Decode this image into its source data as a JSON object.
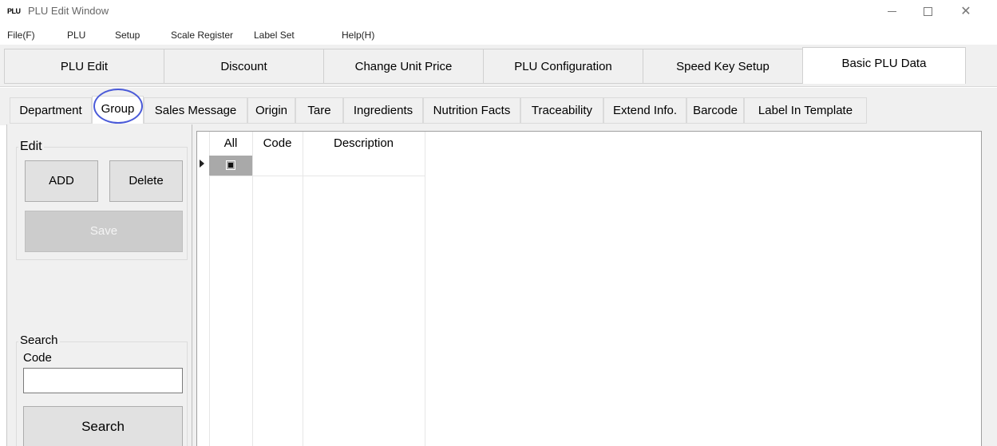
{
  "window": {
    "logo_text": "PLU",
    "title": "PLU Edit Window",
    "minimize_label": "—",
    "maximize_label": "☐",
    "close_label": "✕"
  },
  "menu": [
    "File(F)",
    "PLU",
    "Setup",
    "Scale Register",
    "Label Set",
    "Help(H)"
  ],
  "main_tabs": [
    "PLU Edit",
    "Discount",
    "Change Unit Price",
    "PLU Configuration",
    "Speed Key Setup",
    "Basic PLU Data"
  ],
  "main_tab_active": "Basic PLU Data",
  "sub_tabs": [
    "Department",
    "Group",
    "Sales Message",
    "Origin",
    "Tare",
    "Ingredients",
    "Nutrition Facts",
    "Traceability",
    "Extend Info.",
    "Barcode",
    "Label In Template"
  ],
  "sub_tab_active": "Group",
  "edit": {
    "caption": "Edit",
    "add_label": "ADD",
    "delete_label": "Delete",
    "save_label": "Save"
  },
  "search": {
    "caption": "Search",
    "code_label": "Code",
    "code_value": "",
    "button_label": "Search"
  },
  "grid": {
    "columns": [
      "All",
      "Code",
      "Description"
    ],
    "rows": [
      {
        "all_checked": true,
        "code": "",
        "description": ""
      }
    ]
  },
  "colors": {
    "highlight_ring": "#4a5ad8",
    "panel_bg": "#f0f0f0",
    "selected_cell": "#a9a9a9"
  }
}
